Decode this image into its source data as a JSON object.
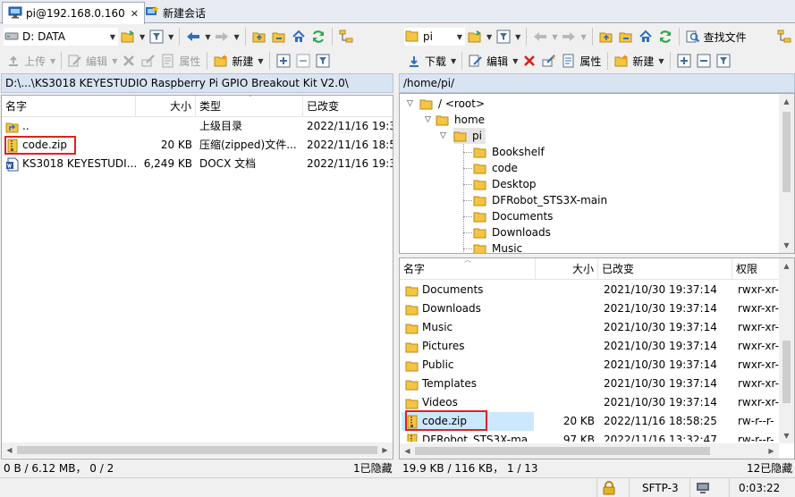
{
  "tabs": [
    {
      "label": "pi@192.168.0.160",
      "close": "✕"
    },
    {
      "label": "新建会话"
    }
  ],
  "left": {
    "drive": "D: DATA",
    "toolbar": {
      "upload": "上传",
      "edit": "编辑",
      "properties": "属性",
      "new": "新建"
    },
    "path": "D:\\...\\KS3018 KEYESTUDIO Raspberry Pi GPIO Breakout Kit V2.0\\",
    "columns": {
      "name": "名字",
      "size": "大小",
      "type": "类型",
      "modified": "已改变"
    },
    "files": [
      {
        "name": "..",
        "size": "",
        "type": "上级目录",
        "modified": "2022/11/16  19:3",
        "icon": "parent-folder-icon"
      },
      {
        "name": "code.zip",
        "size": "20 KB",
        "type": "压缩(zipped)文件...",
        "modified": "2022/11/16  18:5",
        "icon": "zip-file-icon"
      },
      {
        "name": "KS3018 KEYESTUDI...",
        "size": "6,249 KB",
        "type": "DOCX 文档",
        "modified": "2022/11/16  19:3",
        "icon": "docx-file-icon"
      }
    ],
    "status": "0 B / 6.12 MB， 0 / 2",
    "hidden": "1已隐藏"
  },
  "right": {
    "folder": "pi",
    "toolbar": {
      "download": "下载",
      "edit": "编辑",
      "properties": "属性",
      "new": "新建",
      "find": "查找文件"
    },
    "path": "/home/pi/",
    "tree": [
      {
        "label": "/ <root>"
      },
      {
        "label": "home"
      },
      {
        "label": "pi"
      },
      {
        "label": "Bookshelf"
      },
      {
        "label": "code"
      },
      {
        "label": "Desktop"
      },
      {
        "label": "DFRobot_STS3X-main"
      },
      {
        "label": "Documents"
      },
      {
        "label": "Downloads"
      },
      {
        "label": "Music"
      }
    ],
    "columns": {
      "name": "名字",
      "size": "大小",
      "modified": "已改变",
      "rights": "权限"
    },
    "files": [
      {
        "name": "Documents",
        "size": "",
        "modified": "2021/10/30  19:37:14",
        "rights": "rwxr-xr-",
        "icon": "folder-icon"
      },
      {
        "name": "Downloads",
        "size": "",
        "modified": "2021/10/30  19:37:14",
        "rights": "rwxr-xr-",
        "icon": "folder-icon"
      },
      {
        "name": "Music",
        "size": "",
        "modified": "2021/10/30  19:37:14",
        "rights": "rwxr-xr-",
        "icon": "folder-icon"
      },
      {
        "name": "Pictures",
        "size": "",
        "modified": "2021/10/30  19:37:14",
        "rights": "rwxr-xr-",
        "icon": "folder-icon"
      },
      {
        "name": "Public",
        "size": "",
        "modified": "2021/10/30  19:37:14",
        "rights": "rwxr-xr-",
        "icon": "folder-icon"
      },
      {
        "name": "Templates",
        "size": "",
        "modified": "2021/10/30  19:37:14",
        "rights": "rwxr-xr-",
        "icon": "folder-icon"
      },
      {
        "name": "Videos",
        "size": "",
        "modified": "2021/10/30  19:37:14",
        "rights": "rwxr-xr-",
        "icon": "folder-icon"
      },
      {
        "name": "code.zip",
        "size": "20 KB",
        "modified": "2022/11/16  18:58:25",
        "rights": "rw-r--r-",
        "icon": "zip-file-icon"
      },
      {
        "name": "DFRobot_STS3X-ma...",
        "size": "97 KB",
        "modified": "2022/11/16  13:32:47",
        "rights": "rw-r--r-",
        "icon": "zip-file-icon"
      }
    ],
    "status": "19.9 KB / 116 KB， 1 / 13",
    "hidden": "12已隐藏"
  },
  "bottom": {
    "protocol": "SFTP-3",
    "time": "0:03:22"
  },
  "colors": {
    "highlight": "#e02020",
    "selection": "#cce8ff",
    "folder": "#f5c542",
    "path_bar": "#d9e4f2"
  }
}
